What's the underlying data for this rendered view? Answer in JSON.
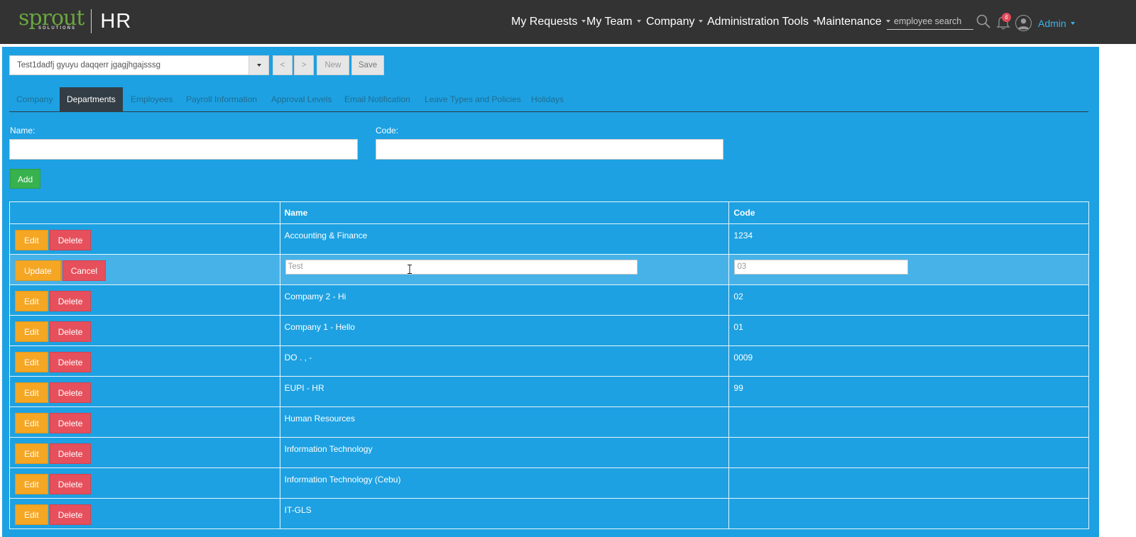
{
  "app": {
    "logo_text": "sprout",
    "logo_sub": "SOLUTIONS",
    "product": "HR"
  },
  "nav": {
    "items": [
      "My Requests",
      "My Team",
      "Company",
      "Administration Tools",
      "Maintenance"
    ],
    "search_placeholder": "employee search",
    "notifications_count": "6",
    "user": "Admin"
  },
  "toolbar": {
    "company_value": "Test1dadfj gyuyu daqqerr jgagjhgajsssg",
    "prev_label": "<",
    "next_label": ">",
    "new_label": "New",
    "save_label": "Save"
  },
  "tabs": [
    "Company",
    "Departments",
    "Employees",
    "Payroll Information",
    "Approval Levels",
    "Email Notification",
    "Leave Types and Policies",
    "Holidays"
  ],
  "active_tab": "Departments",
  "form": {
    "name_label": "Name:",
    "code_label": "Code:",
    "name_value": "",
    "code_value": "",
    "add_label": "Add"
  },
  "table": {
    "headers": [
      "",
      "Name",
      "Code"
    ],
    "edit_label": "Edit",
    "delete_label": "Delete",
    "update_label": "Update",
    "cancel_label": "Cancel",
    "rows": [
      {
        "name": "Accounting & Finance",
        "code": "1234",
        "editing": false
      },
      {
        "name": "Test",
        "code": "03",
        "editing": true
      },
      {
        "name": "Compamy 2 - Hi",
        "code": "02",
        "editing": false
      },
      {
        "name": "Company 1 - Hello",
        "code": "01",
        "editing": false
      },
      {
        "name": "DO . , -",
        "code": "0009",
        "editing": false
      },
      {
        "name": "EUPI - HR",
        "code": "99",
        "editing": false
      },
      {
        "name": "Human Resources",
        "code": "",
        "editing": false
      },
      {
        "name": "Information Technology",
        "code": "",
        "editing": false
      },
      {
        "name": "Information Technology (Cebu)",
        "code": "",
        "editing": false
      },
      {
        "name": "IT-GLS",
        "code": "",
        "editing": false
      }
    ]
  },
  "colors": {
    "topbar": "#333333",
    "panel": "#1da1e2",
    "logo_green": "#6aa640",
    "edit": "#f5a623",
    "delete": "#e6505c",
    "add": "#37b24d",
    "admin": "#3fb2e8"
  }
}
